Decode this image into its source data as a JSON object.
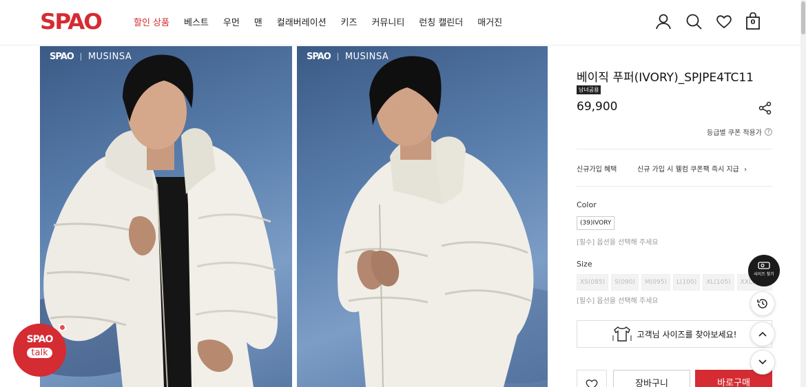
{
  "brand": {
    "logo": "SPAO",
    "accent_color": "#d52b32"
  },
  "nav": [
    "할인 상품",
    "베스트",
    "우먼",
    "맨",
    "컬래버레이션",
    "키즈",
    "커뮤니티",
    "런칭 캘린더",
    "매거진"
  ],
  "header_icons": [
    "user-icon",
    "search-icon",
    "heart-icon",
    "shopping-bag-icon"
  ],
  "cart_count": "0",
  "photos": [
    {
      "brand": "SPAO",
      "partner": "MUSINSA"
    },
    {
      "brand": "SPAO",
      "partner": "MUSINSA"
    }
  ],
  "product": {
    "title": "베이직 푸퍼(IVORY)_SPJPE4TC11",
    "badge": "남녀공용",
    "price": "69,900",
    "coupon_link": "등급별 쿠폰 적용가",
    "benefit_label": "신규가입 혜택",
    "benefit_value": "신규 가입 시 웰컴 쿠폰팩 즉시 지급",
    "color_label": "Color",
    "color_option": "(39)IVORY",
    "color_hint": "[필수] 옵션을 선택해 주세요",
    "size_label": "Size",
    "sizes": [
      "XS(085)",
      "S(090)",
      "M(095)",
      "L(100)",
      "XL(105)",
      "XXL(110)"
    ],
    "size_hint": "[필수] 옵션을 선택해 주세요",
    "size_finder": "고객님 사이즈를 찾아보세요!",
    "cart_button": "장바구니",
    "buy_button": "바로구매"
  },
  "floating": {
    "size_find_label": "사이즈 찾기",
    "talk_logo": "SPAO",
    "talk_label": "talk"
  }
}
